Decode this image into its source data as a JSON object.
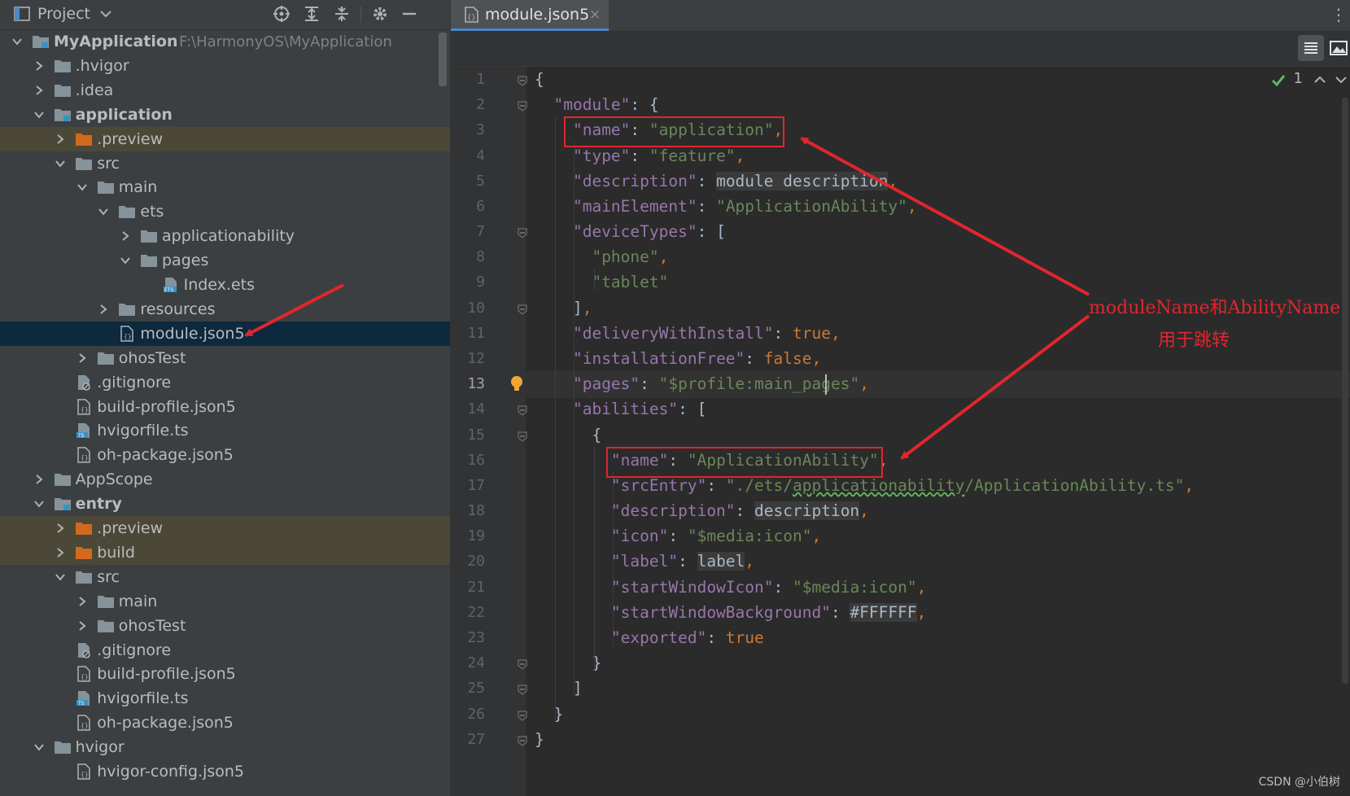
{
  "project_panel": {
    "title": "Project",
    "tree": [
      {
        "label": "MyApplication",
        "path": "F:\\HarmonyOS\\MyApplication",
        "depth": 0,
        "expanded": true,
        "kind": "module",
        "bold": true
      },
      {
        "label": ".hvigor",
        "depth": 1,
        "expanded": false,
        "kind": "folder"
      },
      {
        "label": ".idea",
        "depth": 1,
        "expanded": false,
        "kind": "folder"
      },
      {
        "label": "application",
        "depth": 1,
        "expanded": true,
        "kind": "module",
        "bold": true
      },
      {
        "label": ".preview",
        "depth": 2,
        "expanded": false,
        "kind": "folder-orange",
        "highlight": true
      },
      {
        "label": "src",
        "depth": 2,
        "expanded": true,
        "kind": "folder"
      },
      {
        "label": "main",
        "depth": 3,
        "expanded": true,
        "kind": "folder"
      },
      {
        "label": "ets",
        "depth": 4,
        "expanded": true,
        "kind": "folder"
      },
      {
        "label": "applicationability",
        "depth": 5,
        "expanded": false,
        "kind": "folder"
      },
      {
        "label": "pages",
        "depth": 5,
        "expanded": true,
        "kind": "folder"
      },
      {
        "label": "Index.ets",
        "depth": 6,
        "kind": "ets-file"
      },
      {
        "label": "resources",
        "depth": 4,
        "expanded": false,
        "kind": "folder"
      },
      {
        "label": "module.json5",
        "depth": 4,
        "kind": "json-file",
        "selected": true
      },
      {
        "label": "ohosTest",
        "depth": 3,
        "expanded": false,
        "kind": "folder"
      },
      {
        "label": ".gitignore",
        "depth": 2,
        "kind": "ignore-file"
      },
      {
        "label": "build-profile.json5",
        "depth": 2,
        "kind": "json-file"
      },
      {
        "label": "hvigorfile.ts",
        "depth": 2,
        "kind": "ts-file"
      },
      {
        "label": "oh-package.json5",
        "depth": 2,
        "kind": "json-file"
      },
      {
        "label": "AppScope",
        "depth": 1,
        "expanded": false,
        "kind": "folder"
      },
      {
        "label": "entry",
        "depth": 1,
        "expanded": true,
        "kind": "module",
        "bold": true
      },
      {
        "label": ".preview",
        "depth": 2,
        "expanded": false,
        "kind": "folder-orange",
        "highlight": true
      },
      {
        "label": "build",
        "depth": 2,
        "expanded": false,
        "kind": "folder-orange",
        "highlight": true
      },
      {
        "label": "src",
        "depth": 2,
        "expanded": true,
        "kind": "folder"
      },
      {
        "label": "main",
        "depth": 3,
        "expanded": false,
        "kind": "folder"
      },
      {
        "label": "ohosTest",
        "depth": 3,
        "expanded": false,
        "kind": "folder"
      },
      {
        "label": ".gitignore",
        "depth": 2,
        "kind": "ignore-file"
      },
      {
        "label": "build-profile.json5",
        "depth": 2,
        "kind": "json-file"
      },
      {
        "label": "hvigorfile.ts",
        "depth": 2,
        "kind": "ts-file"
      },
      {
        "label": "oh-package.json5",
        "depth": 2,
        "kind": "json-file"
      },
      {
        "label": "hvigor",
        "depth": 1,
        "expanded": true,
        "kind": "folder"
      },
      {
        "label": "hvigor-config.json5",
        "depth": 2,
        "kind": "json-file"
      }
    ]
  },
  "editor": {
    "tab_label": "module.json5",
    "tab_close": "×",
    "inspection_count": "1",
    "current_line": 13,
    "lines": [
      [
        [
          "punc",
          "{"
        ]
      ],
      [
        [
          "punc",
          "  "
        ],
        [
          "key",
          "\"module\""
        ],
        [
          "punc",
          ": {"
        ]
      ],
      [
        [
          "punc",
          "    "
        ],
        [
          "key",
          "\"name\""
        ],
        [
          "punc",
          ": "
        ],
        [
          "str",
          "\"application\""
        ],
        [
          "kw",
          ","
        ]
      ],
      [
        [
          "punc",
          "    "
        ],
        [
          "key",
          "\"type\""
        ],
        [
          "punc",
          ": "
        ],
        [
          "str",
          "\"feature\""
        ],
        [
          "kw",
          ","
        ]
      ],
      [
        [
          "punc",
          "    "
        ],
        [
          "key",
          "\"description\""
        ],
        [
          "punc",
          ": "
        ],
        [
          "plainbg",
          "module description"
        ],
        [
          "kw",
          ","
        ]
      ],
      [
        [
          "punc",
          "    "
        ],
        [
          "key",
          "\"mainElement\""
        ],
        [
          "punc",
          ": "
        ],
        [
          "str",
          "\"ApplicationAbility\""
        ],
        [
          "kw",
          ","
        ]
      ],
      [
        [
          "punc",
          "    "
        ],
        [
          "key",
          "\"deviceTypes\""
        ],
        [
          "punc",
          ": ["
        ]
      ],
      [
        [
          "punc",
          "      "
        ],
        [
          "str",
          "\"phone\""
        ],
        [
          "kw",
          ","
        ]
      ],
      [
        [
          "punc",
          "      "
        ],
        [
          "str",
          "\"tablet\""
        ]
      ],
      [
        [
          "punc",
          "    ]"
        ],
        [
          "kw",
          ","
        ]
      ],
      [
        [
          "punc",
          "    "
        ],
        [
          "key",
          "\"deliveryWithInstall\""
        ],
        [
          "punc",
          ": "
        ],
        [
          "kw",
          "true,"
        ]
      ],
      [
        [
          "punc",
          "    "
        ],
        [
          "key",
          "\"installationFree\""
        ],
        [
          "punc",
          ": "
        ],
        [
          "kw",
          "false,"
        ]
      ],
      [
        [
          "punc",
          "    "
        ],
        [
          "key",
          "\"pages\""
        ],
        [
          "punc",
          ": "
        ],
        [
          "str",
          "\"$profile:main_pages\""
        ],
        [
          "kw",
          ","
        ]
      ],
      [
        [
          "punc",
          "    "
        ],
        [
          "key",
          "\"abilities\""
        ],
        [
          "punc",
          ": ["
        ]
      ],
      [
        [
          "punc",
          "      {"
        ]
      ],
      [
        [
          "punc",
          "        "
        ],
        [
          "key",
          "\"name\""
        ],
        [
          "punc",
          ": "
        ],
        [
          "str",
          "\"ApplicationAbility\""
        ],
        [
          "kw",
          ","
        ]
      ],
      [
        [
          "punc",
          "        "
        ],
        [
          "key",
          "\"srcEntry\""
        ],
        [
          "punc",
          ": "
        ],
        [
          "str",
          "\"./ets/"
        ],
        [
          "strwavy",
          "applicationability"
        ],
        [
          "str",
          "/ApplicationAbility.ts\""
        ],
        [
          "kw",
          ","
        ]
      ],
      [
        [
          "punc",
          "        "
        ],
        [
          "key",
          "\"description\""
        ],
        [
          "punc",
          ": "
        ],
        [
          "plainbg",
          "description"
        ],
        [
          "kw",
          ","
        ]
      ],
      [
        [
          "punc",
          "        "
        ],
        [
          "key",
          "\"icon\""
        ],
        [
          "punc",
          ": "
        ],
        [
          "str",
          "\"$media:icon\""
        ],
        [
          "kw",
          ","
        ]
      ],
      [
        [
          "punc",
          "        "
        ],
        [
          "key",
          "\"label\""
        ],
        [
          "punc",
          ": "
        ],
        [
          "plainbg",
          "label"
        ],
        [
          "kw",
          ","
        ]
      ],
      [
        [
          "punc",
          "        "
        ],
        [
          "key",
          "\"startWindowIcon\""
        ],
        [
          "punc",
          ": "
        ],
        [
          "str",
          "\"$media:icon\""
        ],
        [
          "kw",
          ","
        ]
      ],
      [
        [
          "punc",
          "        "
        ],
        [
          "key",
          "\"startWindowBackground\""
        ],
        [
          "punc",
          ": "
        ],
        [
          "plainbg",
          "#FFFFFF"
        ],
        [
          "kw",
          ","
        ]
      ],
      [
        [
          "punc",
          "        "
        ],
        [
          "key",
          "\"exported\""
        ],
        [
          "punc",
          ": "
        ],
        [
          "kw",
          "true"
        ]
      ],
      [
        [
          "punc",
          "      }"
        ]
      ],
      [
        [
          "punc",
          "    ]"
        ]
      ],
      [
        [
          "punc",
          "  }"
        ]
      ],
      [
        [
          "punc",
          "}"
        ]
      ]
    ]
  },
  "annotation": {
    "line1": "moduleName和AbilityName",
    "line2": "用于跳转"
  },
  "watermark": "CSDN @小伯树",
  "colors": {
    "accent": "#4a88c7",
    "annotation_red": "#e0262e",
    "selected_row": "#0d293e",
    "excluded_row": "#4c4838"
  }
}
